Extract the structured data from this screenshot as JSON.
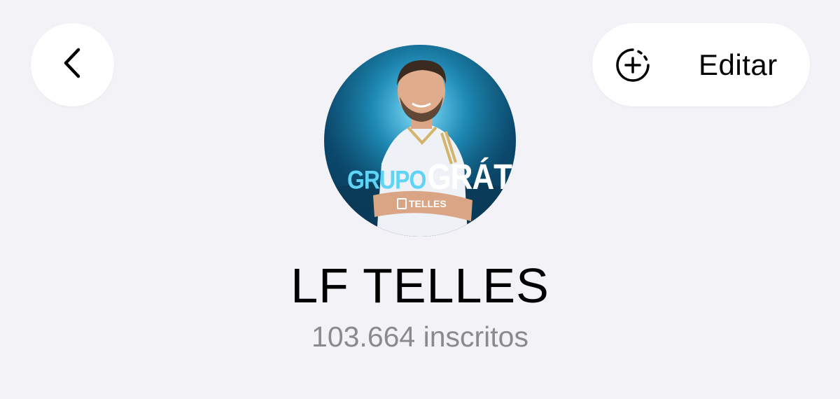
{
  "header": {
    "back_icon": "chevron-left-icon",
    "edit_icon": "add-circle-dashed-icon",
    "edit_label": "Editar"
  },
  "channel": {
    "avatar_text_primary": "GRUPO",
    "avatar_text_secondary": "GRÁTIS",
    "avatar_logo_text": "TELLES",
    "name": "LF TELLES",
    "subscribers": "103.664 inscritos"
  },
  "colors": {
    "background": "#f2f2f7",
    "button_background": "#ffffff",
    "subscribers_text": "#8a8a8e",
    "avatar_accent": "#5fd4f5"
  }
}
